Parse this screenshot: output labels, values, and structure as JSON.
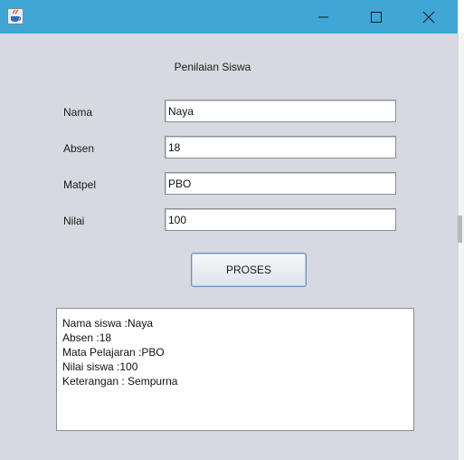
{
  "window": {
    "controls": {
      "minimize_icon": "minimize-icon",
      "maximize_icon": "maximize-icon",
      "close_icon": "close-icon"
    },
    "titlebar_color": "#3fa6d6",
    "background_color": "#d6d9df"
  },
  "form": {
    "title": "Penilaian Siswa",
    "fields": [
      {
        "label": "Nama",
        "value": "Naya"
      },
      {
        "label": "Absen",
        "value": "18"
      },
      {
        "label": "Matpel",
        "value": "PBO"
      },
      {
        "label": "Nilai",
        "value": "100"
      }
    ],
    "submit_label": "PROSES"
  },
  "output": {
    "lines": [
      "Nama siswa :Naya",
      "Absen :18",
      "Mata Pelajaran :PBO",
      "Nilai siswa :100",
      "Keterangan : Sempurna"
    ]
  }
}
